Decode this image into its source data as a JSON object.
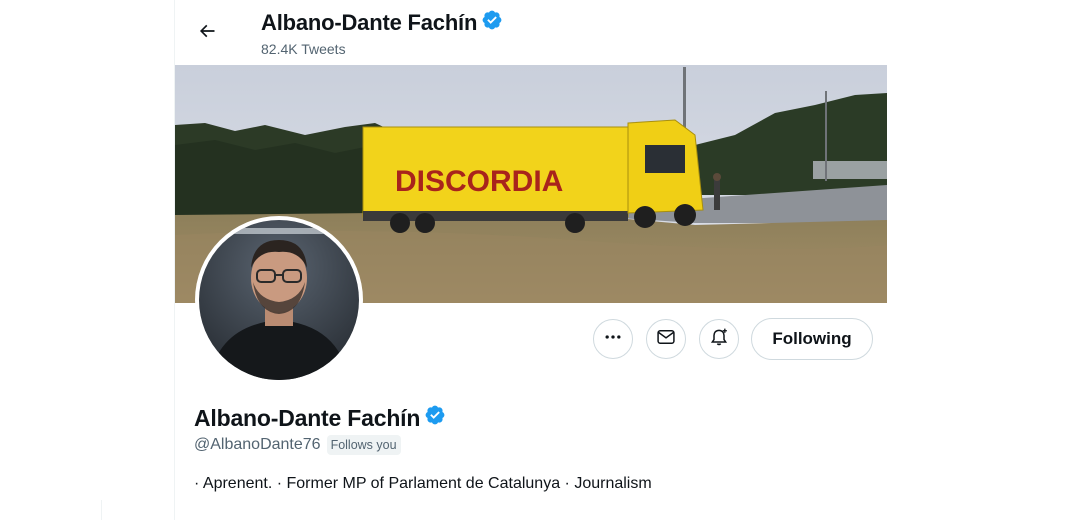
{
  "header": {
    "name": "Albano-Dante Fachín",
    "tweet_count": "82.4K Tweets",
    "back_icon": "arrow-left-icon"
  },
  "banner": {
    "truck_text": "DISCORDIA",
    "description_icon": "banner-image"
  },
  "actions": {
    "more_icon": "more-dots-icon",
    "message_icon": "envelope-icon",
    "notify_icon": "bell-plus-icon",
    "follow_label": "Following"
  },
  "profile": {
    "name": "Albano-Dante Fachín",
    "handle": "@AlbanoDante76",
    "follows_you": "Follows you",
    "bio": "· Aprenent. · Former MP of Parlament de Catalunya · Journalism"
  },
  "colors": {
    "verified": "#1d9bf0",
    "text_primary": "#0f1419",
    "text_secondary": "#536471",
    "border": "#cfd9de"
  }
}
